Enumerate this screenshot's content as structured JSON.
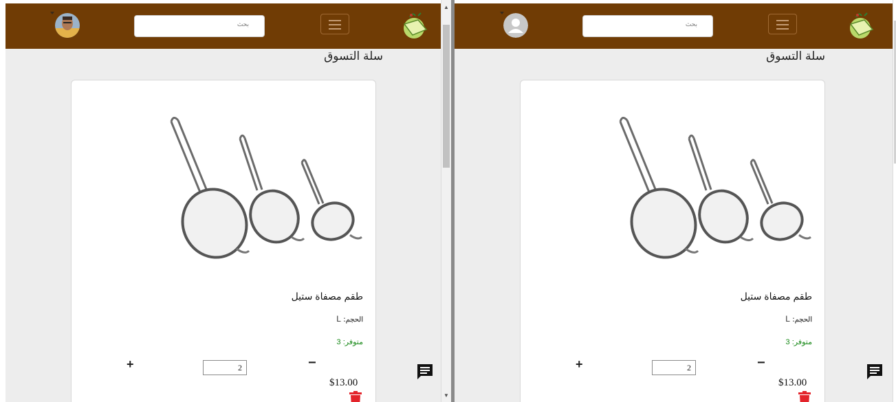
{
  "left_view": {
    "search_placeholder": "بحث",
    "page_title": "سلة التسوق",
    "product": {
      "name": "طقم مصفاة ستيل",
      "size_label": "الحجم:",
      "size_value": "L",
      "stock_label": "متوفر:",
      "stock_value": "3",
      "quantity": "2",
      "plus": "+",
      "minus": "−",
      "price": "$13.00"
    },
    "icons": [
      "logo-icon",
      "menu-icon",
      "user-avatar",
      "product-image",
      "trash-icon",
      "chat-icon"
    ]
  },
  "right_view": {
    "search_placeholder": "بحث",
    "page_title": "سلة التسوق",
    "product": {
      "name": "طقم مصفاة ستيل",
      "size_label": "الحجم:",
      "size_value": "L",
      "stock_label": "متوفر:",
      "stock_value": "3",
      "quantity": "2",
      "plus": "+",
      "minus": "−",
      "price": "$13.00"
    },
    "icons": [
      "logo-icon",
      "menu-icon",
      "default-avatar-icon",
      "product-image",
      "trash-icon",
      "chat-icon"
    ]
  },
  "colors": {
    "navbar": "#703c05",
    "background": "#ededed",
    "stock_text": "#1a8a1a",
    "trash": "#e3242b"
  }
}
